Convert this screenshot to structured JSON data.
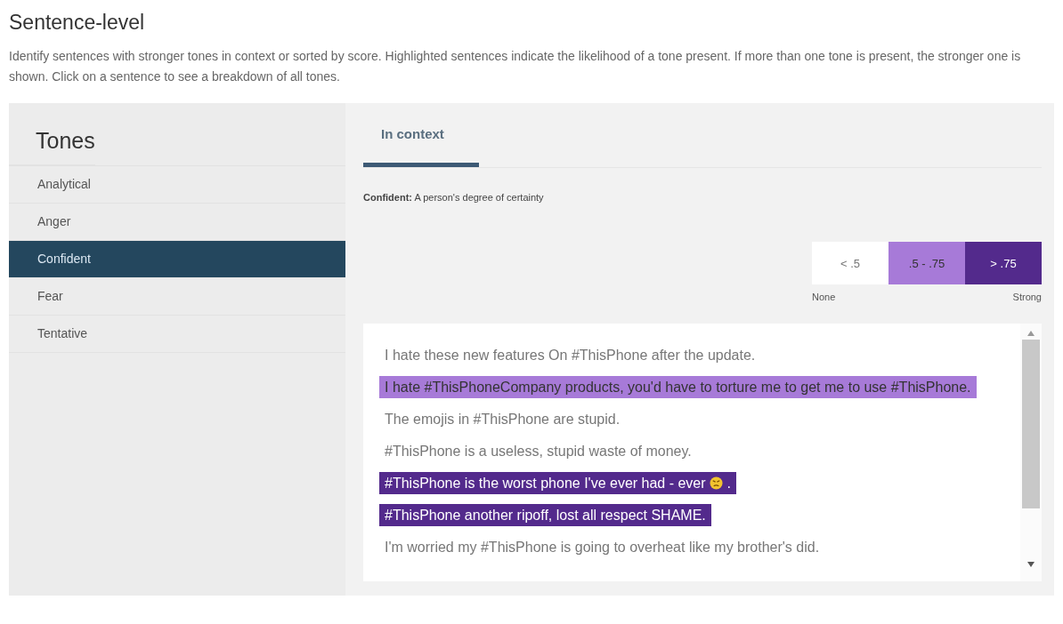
{
  "header": {
    "title": "Sentence-level",
    "description": "Identify sentences with stronger tones in context or sorted by score. Highlighted sentences indicate the likelihood of a tone present. If more than one tone is present, the stronger one is shown. Click on a sentence to see a breakdown of all tones."
  },
  "sidebar": {
    "title": "Tones",
    "items": [
      {
        "label": "Analytical",
        "selected": false
      },
      {
        "label": "Anger",
        "selected": false
      },
      {
        "label": "Confident",
        "selected": true
      },
      {
        "label": "Fear",
        "selected": false
      },
      {
        "label": "Tentative",
        "selected": false
      }
    ]
  },
  "tabs": [
    {
      "label": "In context",
      "selected": true
    }
  ],
  "definition": "**Confident:** A person's degree of certainty",
  "legend": {
    "bands": [
      {
        "label": "< .5",
        "color": "#ffffff"
      },
      {
        "label": ".5 - .75",
        "color": "#a77ad8"
      },
      {
        "label": "> .75",
        "color": "#532a8c"
      }
    ],
    "low_label": "None",
    "high_label": "Strong"
  },
  "sentences": [
    {
      "text": "I hate these new features On #ThisPhone after the update.",
      "kind": "plain"
    },
    {
      "text": "I hate #ThisPhoneCompany products, you'd have to torture me to get me to use #ThisPhone.",
      "kind": "moderate"
    },
    {
      "text": "The emojis in #ThisPhone are stupid.",
      "kind": "plain"
    },
    {
      "text": "#ThisPhone is a useless, stupid waste of money.",
      "kind": "plain"
    },
    {
      "text": "#ThisPhone is the worst phone I've ever had - ever",
      "emoji": true,
      "after": ".",
      "kind": "strong"
    },
    {
      "text": "#ThisPhone another ripoff, lost all respect SHAME.",
      "kind": "strong"
    },
    {
      "text": "I'm worried my #ThisPhone is going to overheat like my brother's did.",
      "kind": "plain"
    }
  ]
}
